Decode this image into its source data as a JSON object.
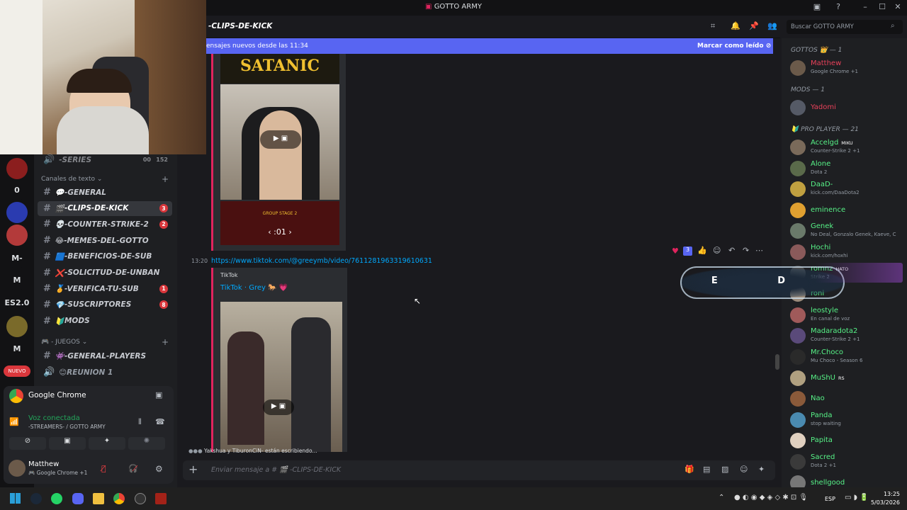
{
  "window": {
    "title": "GOTTO ARMY"
  },
  "guilds": [
    {
      "label": "",
      "badge": "43",
      "color": "#8b1e1e"
    },
    {
      "label": "0",
      "badge": "",
      "color": "#121214"
    },
    {
      "label": "",
      "badge": "",
      "color": "#2a3bb0"
    },
    {
      "label": "",
      "badge": "30",
      "color": "#b33a3a"
    },
    {
      "label": "M-",
      "badge": "",
      "color": "#121214"
    },
    {
      "label": "M",
      "badge": "",
      "color": "#121214"
    },
    {
      "label": "ES2.0",
      "badge": "",
      "color": "#121214"
    },
    {
      "label": "",
      "badge": "",
      "color": "#7a6a2a"
    },
    {
      "label": "M",
      "badge": "",
      "color": "#121214"
    }
  ],
  "guild_new_label": "NUEVO",
  "sidebar": {
    "top_channel": {
      "name": "-SERIES",
      "count_a": "00",
      "count_b": "152"
    },
    "text_category": "Canales de texto",
    "channels": [
      {
        "emoji": "💬",
        "name": "-GENERAL",
        "badge": ""
      },
      {
        "emoji": "🎬",
        "name": "-CLIPS-DE-KICK",
        "badge": "3"
      },
      {
        "emoji": "💀",
        "name": "-COUNTER-STRIKE-2",
        "badge": "2"
      },
      {
        "emoji": "😂",
        "name": "-MEMES-DEL-GOTTO",
        "badge": ""
      },
      {
        "emoji": "🟦",
        "name": "-BENEFICIOS-DE-SUB",
        "badge": ""
      },
      {
        "emoji": "❌",
        "name": "-SOLICITUD-DE-UNBAN",
        "badge": ""
      },
      {
        "emoji": "🏅",
        "name": "-VERIFICA-TU-SUB",
        "badge": "1"
      },
      {
        "emoji": "💎",
        "name": "-SUSCRIPTORES",
        "badge": "8"
      },
      {
        "emoji": "🔰",
        "name": "MODS",
        "badge": ""
      }
    ],
    "games_category": "- JUEGOS",
    "game_channels": [
      {
        "emoji": "👾",
        "name": "-GENERAL-PLAYERS",
        "kind": "text"
      },
      {
        "emoji": "😊",
        "name": "REUNION 1",
        "kind": "voice"
      }
    ]
  },
  "stream": {
    "app": "Google Chrome"
  },
  "voice": {
    "status": "Voz conectada",
    "channel": "-STREAMERS- / GOTTO ARMY"
  },
  "user": {
    "name": "Matthew",
    "activity": "Google Chrome +1"
  },
  "chat": {
    "channel_name": "-CLIPS-DE-KICK",
    "new_messages": "ensajes nuevos desde las 11:34",
    "mark_read": "Marcar como leído",
    "first_embed_text": "SATANIC",
    "stream_overlay_text": "GROUP STAGE 2",
    "timer_text": ":01",
    "message_time": "13:20",
    "message_link": "https://www.tiktok.com/@greeymb/video/7611281963319610631",
    "embed_provider": "TikTok",
    "embed_title": "TikTok · Grey 🐎 💗",
    "reaction_count": "3",
    "typing": "Yakshua y TiburonCiN- están escribiendo...",
    "input_placeholder": "Enviar mensaje a # 🎬 -CLIPS-DE-KICK"
  },
  "search": {
    "placeholder": "Buscar GOTTO ARMY"
  },
  "members": {
    "groups": [
      {
        "title": "GOTTOS 👑 — 1",
        "members": [
          {
            "name": "Matthew",
            "status": "Google Chrome +1",
            "color": "#e8415a",
            "badge": ""
          }
        ]
      },
      {
        "title": "MODS — 1",
        "members": [
          {
            "name": "Yadomi",
            "status": "",
            "color": "#e8415a",
            "badge": ""
          }
        ]
      },
      {
        "title": "🔰 PRO PLAYER — 21",
        "members": [
          {
            "name": "Accelgd",
            "status": "Counter-Strike 2 +1",
            "color": "#57f287",
            "badge": "MIKU"
          },
          {
            "name": "Alone",
            "status": "Dota 2",
            "color": "#57f287",
            "badge": ""
          },
          {
            "name": "DaaD-",
            "status": "kick.com/DaaDota2",
            "color": "#57f287",
            "badge": ""
          },
          {
            "name": "eminence",
            "status": "",
            "color": "#57f287",
            "badge": ""
          },
          {
            "name": "Genek",
            "status": "No Deal, Gonzalo Genek, Kaeve, C",
            "color": "#57f287",
            "badge": ""
          },
          {
            "name": "Hochi",
            "status": "kick.com/hoxhi",
            "color": "#57f287",
            "badge": ""
          },
          {
            "name": "romnz",
            "status": "Strike 2",
            "color": "#57f287",
            "badge": "HATO"
          },
          {
            "name": "roni",
            "status": "",
            "color": "#57f287",
            "badge": ""
          },
          {
            "name": "leostyle",
            "status": "En canal de voz",
            "color": "#57f287",
            "badge": ""
          },
          {
            "name": "Madaradota2",
            "status": "Counter-Strike 2 +1",
            "color": "#57f287",
            "badge": ""
          },
          {
            "name": "Mr.Choco",
            "status": "Mu Choco - Season 6",
            "color": "#57f287",
            "badge": ""
          },
          {
            "name": "MuShU",
            "status": "",
            "color": "#57f287",
            "badge": "RS"
          },
          {
            "name": "Nao",
            "status": "",
            "color": "#57f287",
            "badge": ""
          },
          {
            "name": "Panda",
            "status": "stop waiting",
            "color": "#57f287",
            "badge": ""
          },
          {
            "name": "Papita",
            "status": "",
            "color": "#57f287",
            "badge": ""
          },
          {
            "name": "Sacred",
            "status": "Dota 2 +1",
            "color": "#57f287",
            "badge": ""
          },
          {
            "name": "shellgood",
            "status": "",
            "color": "#57f287",
            "badge": ""
          }
        ]
      }
    ],
    "overlay_text": "E D"
  },
  "taskbar": {
    "lang": "ESP",
    "time": "13:25",
    "date": "5/03/2026"
  }
}
